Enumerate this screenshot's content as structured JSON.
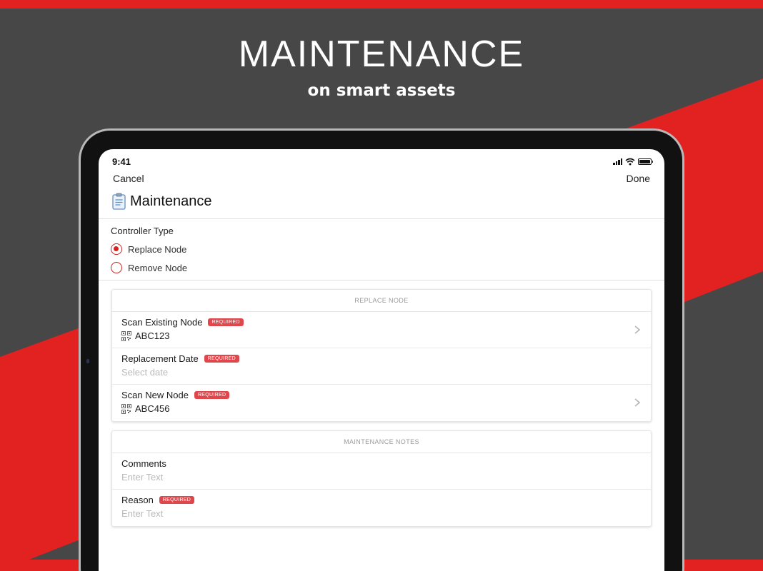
{
  "hero": {
    "title": "MAINTENANCE",
    "subtitle": "on smart assets"
  },
  "colors": {
    "accent": "#e22220",
    "background": "#474747",
    "required_badge": "#e0474c"
  },
  "status_bar": {
    "time": "9:41",
    "icons": [
      "signal-icon",
      "wifi-icon",
      "battery-icon"
    ]
  },
  "nav": {
    "cancel_label": "Cancel",
    "done_label": "Done"
  },
  "page": {
    "icon": "clipboard-icon",
    "title": "Maintenance"
  },
  "controller_type": {
    "label": "Controller Type",
    "options": [
      {
        "label": "Replace Node",
        "selected": true
      },
      {
        "label": "Remove Node",
        "selected": false
      }
    ]
  },
  "replace_section": {
    "header": "REPLACE NODE",
    "required_label": "REQUIRED",
    "rows": [
      {
        "label": "Scan Existing Node",
        "value": "ABC123",
        "icon": "qr-code-icon"
      },
      {
        "label": "Replacement Date",
        "placeholder": "Select date"
      },
      {
        "label": "Scan New Node",
        "value": "ABC456",
        "icon": "qr-code-icon"
      }
    ]
  },
  "notes_section": {
    "header": "MAINTENANCE NOTES",
    "required_label": "REQUIRED",
    "rows": [
      {
        "label": "Comments",
        "placeholder": "Enter Text"
      },
      {
        "label": "Reason",
        "placeholder": "Enter Text"
      }
    ]
  }
}
